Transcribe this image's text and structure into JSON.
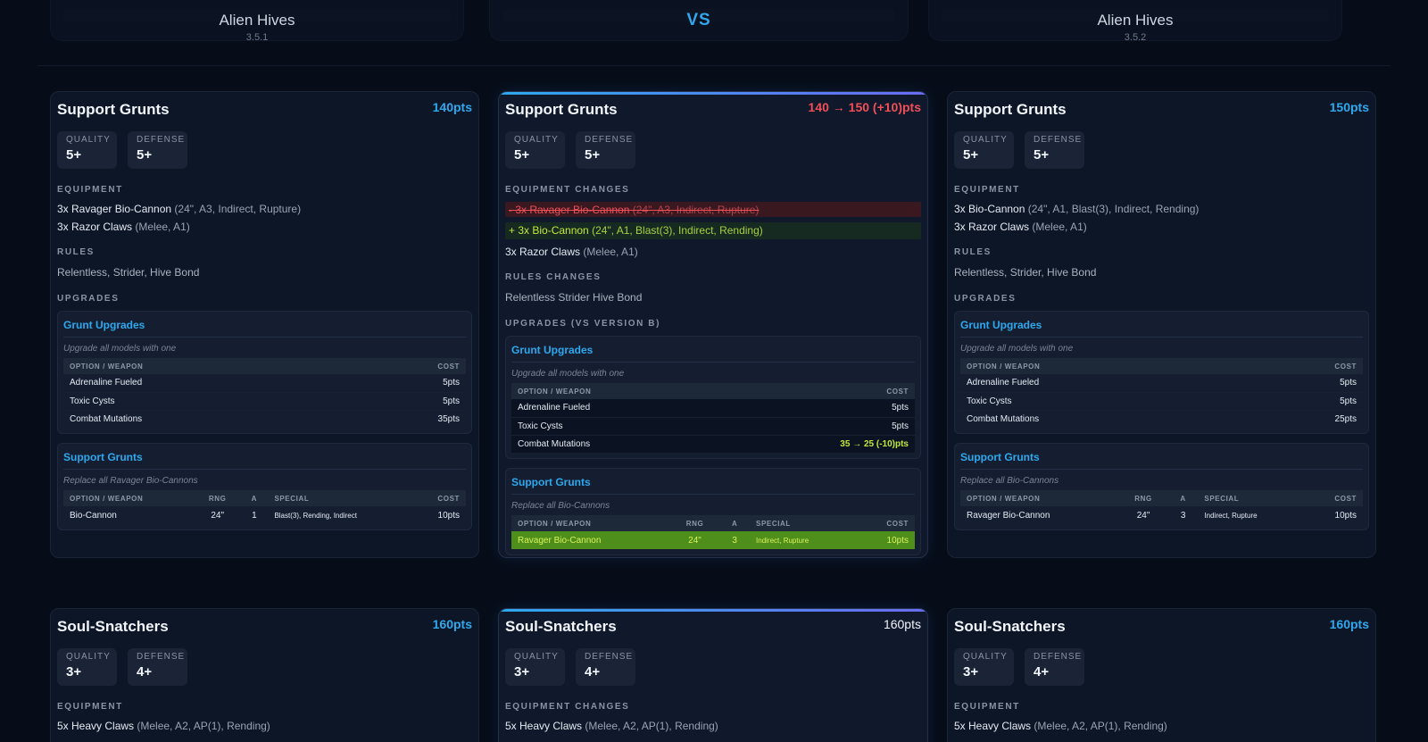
{
  "header": {
    "left": {
      "name": "Alien Hives",
      "version": "3.5.1"
    },
    "vs": "VS",
    "right": {
      "name": "Alien Hives",
      "version": "3.5.2"
    }
  },
  "labels": {
    "quality": "QUALITY",
    "defense": "DEFENSE",
    "equipment": "EQUIPMENT",
    "equipment_changes": "EQUIPMENT CHANGES",
    "rules": "RULES",
    "rules_changes": "RULES CHANGES",
    "upgrades": "UPGRADES",
    "upgrades_vs": "UPGRADES (VS VERSION B)",
    "col_option": "OPTION / WEAPON",
    "col_cost": "COST",
    "col_rng": "RNG",
    "col_a": "A",
    "col_special": "SPECIAL"
  },
  "units": [
    {
      "left": {
        "title": "Support Grunts",
        "points": "140pts",
        "quality": "5+",
        "defense": "5+",
        "equipment": [
          {
            "name": "3x Ravager Bio-Cannon",
            "detail": "(24\", A3, Indirect, Rupture)"
          },
          {
            "name": "3x Razor Claws",
            "detail": "(Melee, A1)"
          }
        ],
        "rules": "Relentless, Strider, Hive Bond",
        "groups": [
          {
            "title": "Grunt Upgrades",
            "desc": "Upgrade all models with one",
            "rows": [
              {
                "name": "Adrenaline Fueled",
                "cost": "5pts"
              },
              {
                "name": "Toxic Cysts",
                "cost": "5pts"
              },
              {
                "name": "Combat Mutations",
                "cost": "35pts"
              }
            ]
          },
          {
            "title": "Support Grunts",
            "desc": "Replace all Ravager Bio-Cannons",
            "rows": [
              {
                "name": "Bio-Cannon",
                "rng": "24\"",
                "a": "1",
                "special": "Blast(3), Rending, Indirect",
                "cost": "10pts"
              }
            ]
          }
        ]
      },
      "mid": {
        "title": "Support Grunts",
        "points": "140 → 150 (+10)pts",
        "quality": "5+",
        "defense": "5+",
        "removed": {
          "name": "- 3x Ravager Bio-Cannon",
          "detail": "(24\", A3, Indirect, Rupture)"
        },
        "added": {
          "name": "+ 3x Bio-Cannon",
          "detail": "(24\", A1, Blast(3), Indirect, Rending)"
        },
        "unchanged": {
          "name": "3x Razor Claws",
          "detail": "(Melee, A1)"
        },
        "rules": "Relentless Strider Hive Bond",
        "groups": [
          {
            "title": "Grunt Upgrades",
            "desc": "Upgrade all models with one",
            "rows": [
              {
                "name": "Adrenaline Fueled",
                "cost": "5pts"
              },
              {
                "name": "Toxic Cysts",
                "cost": "5pts"
              },
              {
                "name": "Combat Mutations",
                "cost": "35 → 25 (-10)pts"
              }
            ]
          },
          {
            "title": "Support Grunts",
            "desc": "Replace all Bio-Cannons",
            "rows": [
              {
                "name": "Ravager Bio-Cannon",
                "rng": "24\"",
                "a": "3",
                "special": "Indirect, Rupture",
                "cost": "10pts"
              }
            ]
          }
        ]
      },
      "right": {
        "title": "Support Grunts",
        "points": "150pts",
        "quality": "5+",
        "defense": "5+",
        "equipment": [
          {
            "name": "3x Bio-Cannon",
            "detail": "(24\", A1, Blast(3), Indirect, Rending)"
          },
          {
            "name": "3x Razor Claws",
            "detail": "(Melee, A1)"
          }
        ],
        "rules": "Relentless, Strider, Hive Bond",
        "groups": [
          {
            "title": "Grunt Upgrades",
            "desc": "Upgrade all models with one",
            "rows": [
              {
                "name": "Adrenaline Fueled",
                "cost": "5pts"
              },
              {
                "name": "Toxic Cysts",
                "cost": "5pts"
              },
              {
                "name": "Combat Mutations",
                "cost": "25pts"
              }
            ]
          },
          {
            "title": "Support Grunts",
            "desc": "Replace all Bio-Cannons",
            "rows": [
              {
                "name": "Ravager Bio-Cannon",
                "rng": "24\"",
                "a": "3",
                "special": "Indirect, Rupture",
                "cost": "10pts"
              }
            ]
          }
        ]
      }
    },
    {
      "left": {
        "title": "Soul-Snatchers",
        "points": "160pts",
        "quality": "3+",
        "defense": "4+",
        "equipment": [
          {
            "name": "5x Heavy Claws",
            "detail": "(Melee, A2, AP(1), Rending)"
          }
        ]
      },
      "mid": {
        "title": "Soul-Snatchers",
        "points": "160pts",
        "quality": "3+",
        "defense": "4+",
        "equipment": [
          {
            "name": "5x Heavy Claws",
            "detail": "(Melee, A2, AP(1), Rending)"
          }
        ]
      },
      "right": {
        "title": "Soul-Snatchers",
        "points": "160pts",
        "quality": "3+",
        "defense": "4+",
        "equipment": [
          {
            "name": "5x Heavy Claws",
            "detail": "(Melee, A2, AP(1), Rending)"
          }
        ]
      }
    }
  ]
}
